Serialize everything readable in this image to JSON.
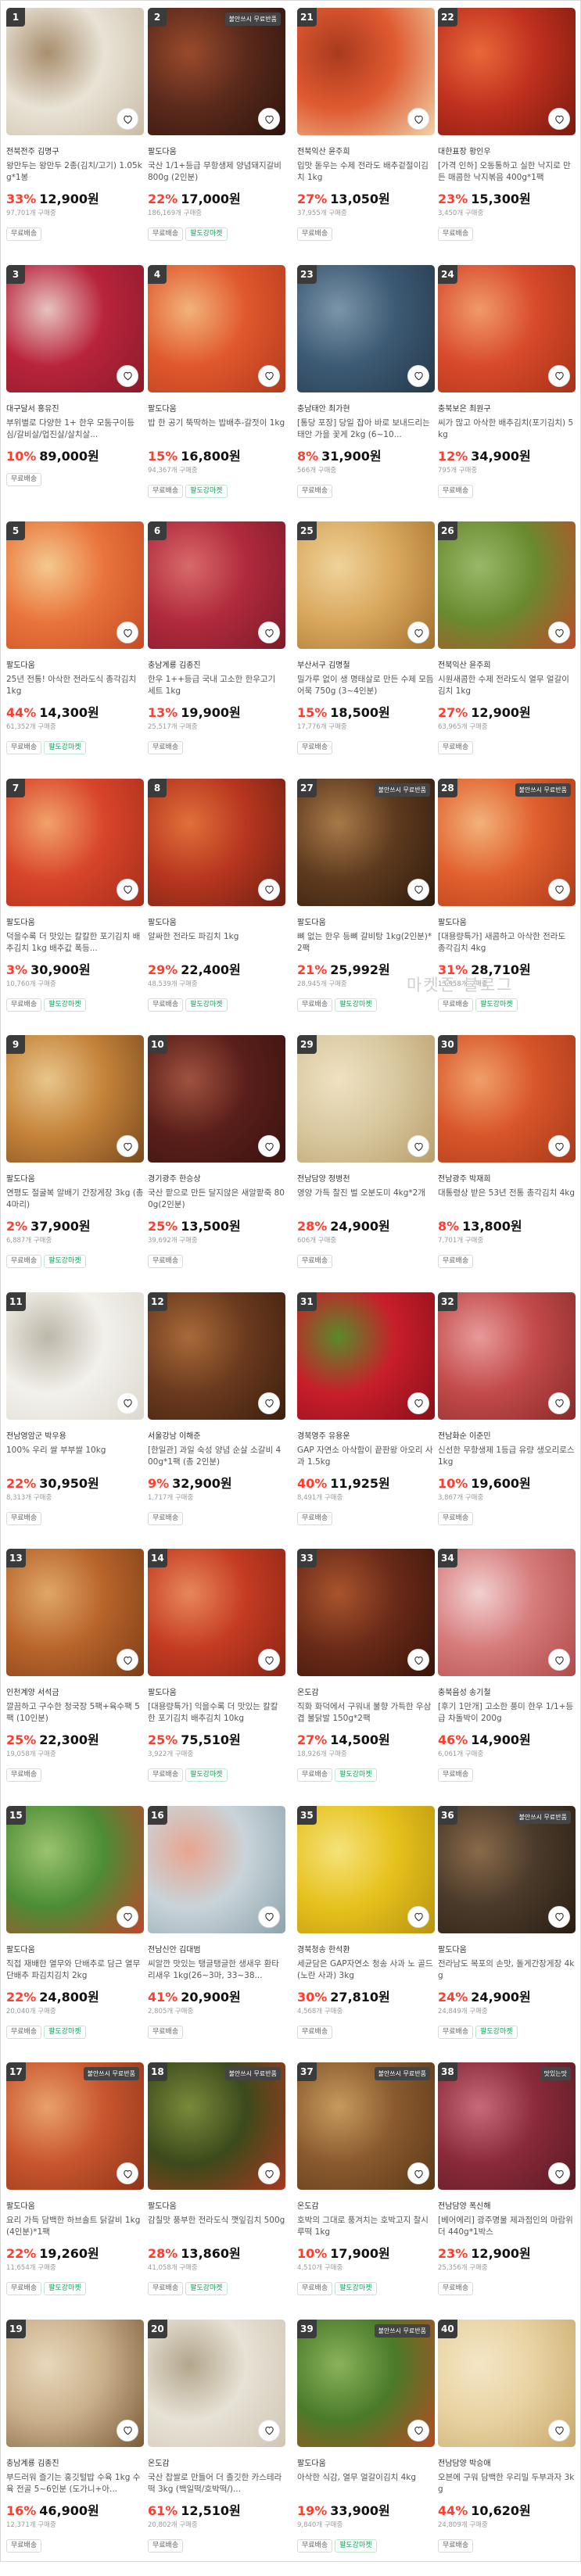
{
  "watermark": "마켓존 블로그",
  "columns": [
    {
      "products": [
        {
          "rank": "1",
          "badge": "",
          "store": "전북전주 김명구",
          "name": "왕만두는 왕만두 2종(김치/고기) 1.05kg*1봉",
          "discount": "33%",
          "price": "12,900원",
          "buyers": "97,701개 구매중",
          "tags": [
            "무료배송"
          ],
          "img_colors": [
            "#e9e3d6",
            "#c9bca6",
            "#a88e6e"
          ]
        },
        {
          "rank": "3",
          "badge": "",
          "store": "대구달서 홍유진",
          "name": "부위별로 다양한 1+ 한우 모둠구이등심/갈비살/업진살/살치살...",
          "discount": "10%",
          "price": "89,000원",
          "buyers": "",
          "tags": [
            "무료배송"
          ],
          "img_colors": [
            "#b8243a",
            "#8c1a2c",
            "#e7c3c0"
          ]
        },
        {
          "rank": "5",
          "badge": "",
          "store": "팔도다움",
          "name": "25년 전통! 아삭한 전라도식 총각김치 1kg",
          "discount": "44%",
          "price": "14,300원",
          "buyers": "61,352개 구매중",
          "tags": [
            "무료배송",
            "팔도강마켓"
          ],
          "img_colors": [
            "#e9743b",
            "#c64b25",
            "#f4c98d"
          ]
        },
        {
          "rank": "7",
          "badge": "",
          "store": "팔도다움",
          "name": "덕을수록 더 맛있는 칼칼한 포기김치 배추김치 1kg 배추값 폭등...",
          "discount": "3%",
          "price": "30,900원",
          "buyers": "10,760개 구매중",
          "tags": [
            "무료배송",
            "팔도강마켓"
          ],
          "img_colors": [
            "#d8452a",
            "#a72d1c",
            "#f2a26a"
          ]
        },
        {
          "rank": "9",
          "badge": "",
          "store": "팔도다움",
          "name": "연평도 절굴복 알배기 간장게장 3kg (총 4마리)",
          "discount": "2%",
          "price": "37,900원",
          "buyers": "6,887개 구매중",
          "tags": [
            "무료배송",
            "팔도강마켓"
          ],
          "img_colors": [
            "#c5833a",
            "#7a4a1e",
            "#e8c68b"
          ]
        },
        {
          "rank": "11",
          "badge": "",
          "store": "전남영암군 박우용",
          "name": "100% 우리 쌀 부부쌀 10kg",
          "discount": "22%",
          "price": "30,950원",
          "buyers": "8,313개 구매중",
          "tags": [
            "무료배송"
          ],
          "img_colors": [
            "#f3f1ec",
            "#dcd8cf",
            "#bdb7a9"
          ]
        },
        {
          "rank": "13",
          "badge": "",
          "store": "인천계양 서석금",
          "name": "깔끔하고 구수한 청국장 5팩+육수팩 5팩 (10인분)",
          "discount": "25%",
          "price": "22,300원",
          "buyers": "19,058개 구매중",
          "tags": [
            "무료배송"
          ],
          "img_colors": [
            "#b8642b",
            "#7d3e16",
            "#e0a768"
          ]
        },
        {
          "rank": "15",
          "badge": "",
          "store": "팔도다움",
          "name": "직접 재배한 열무와 단배추로 담근 열무단배추 파김치김치 2kg",
          "discount": "22%",
          "price": "24,800원",
          "buyers": "20,040개 구매중",
          "tags": [
            "무료배송",
            "팔도강마켓"
          ],
          "img_colors": [
            "#4d8c35",
            "#c0452b",
            "#9bc36f"
          ]
        },
        {
          "rank": "17",
          "badge": "불안쓰시 무료반품",
          "store": "팔도다움",
          "name": "요리 가득 담백한 하브솔트 닭갈비 1kg(4인분)*1팩",
          "discount": "22%",
          "price": "19,260원",
          "buyers": "11,654개 구매중",
          "tags": [
            "무료배송",
            "팔도강마켓"
          ],
          "img_colors": [
            "#c8562e",
            "#8f3419",
            "#e9a16b"
          ]
        },
        {
          "rank": "19",
          "badge": "",
          "store": "충남계룡 김종진",
          "name": "부드러워 즐기는 홍깃털밥 수육 1kg 수육 전골 5~6인분 (도가니+아...",
          "discount": "16%",
          "price": "46,900원",
          "buyers": "12,371개 구매중",
          "tags": [
            "무료배송"
          ],
          "img_colors": [
            "#c9b08a",
            "#7b5a38",
            "#e8d8bd"
          ]
        }
      ]
    },
    {
      "products": [
        {
          "rank": "2",
          "badge": "불안쓰시 무료반품",
          "store": "팔도다움",
          "name": "국산 1/1+등급 무항생제 양념돼지갈비 800g (2인분)",
          "discount": "22%",
          "price": "17,000원",
          "buyers": "186,169개 구매중",
          "tags": [
            "무료배송",
            "팔도강마켓"
          ],
          "img_colors": [
            "#5a2a1c",
            "#2e140c",
            "#9a4a2c"
          ]
        },
        {
          "rank": "4",
          "badge": "",
          "store": "팔도다움",
          "name": "밥 한 공기 뚝딱하는 밥배추-갈젓이 1kg",
          "discount": "15%",
          "price": "16,800원",
          "buyers": "94,367개 구매중",
          "tags": [
            "무료배송",
            "팔도강마켓"
          ],
          "img_colors": [
            "#e0582d",
            "#b33a1c",
            "#f3b37a"
          ]
        },
        {
          "rank": "6",
          "badge": "",
          "store": "충남계룡 김종진",
          "name": "한우 1++등급 국내 고소한 한우고기 세트 1kg",
          "discount": "13%",
          "price": "19,900원",
          "buyers": "25,517개 구매중",
          "tags": [
            "무료배송"
          ],
          "img_colors": [
            "#b02a3c",
            "#7e1a28",
            "#d86a6a"
          ]
        },
        {
          "rank": "8",
          "badge": "",
          "store": "팔도다움",
          "name": "알싸한 전라도 파김치 1kg",
          "discount": "29%",
          "price": "22,400원",
          "buyers": "48,539개 구매중",
          "tags": [
            "무료배송",
            "팔도강마켓"
          ],
          "img_colors": [
            "#b8361f",
            "#6e2013",
            "#e0703a"
          ]
        },
        {
          "rank": "10",
          "badge": "",
          "store": "경기광주 한승상",
          "name": "국산 팥으로 만든 달지않은 새알팥죽 800g(2인분)",
          "discount": "25%",
          "price": "13,500원",
          "buyers": "39,692개 구매중",
          "tags": [
            "무료배송"
          ],
          "img_colors": [
            "#5a1f1a",
            "#3a120f",
            "#a0523f"
          ]
        },
        {
          "rank": "12",
          "badge": "",
          "store": "서울강남 이해준",
          "name": "[한일관] 과일 숙성 양념 순살 소갈비 400g*1팩 (총 2인분)",
          "discount": "9%",
          "price": "32,900원",
          "buyers": "1,717개 구매중",
          "tags": [
            "무료배송"
          ],
          "img_colors": [
            "#6b3a1e",
            "#3c1f0e",
            "#a86a3a"
          ]
        },
        {
          "rank": "14",
          "badge": "",
          "store": "팔도다움",
          "name": "[대용량특가] 익을수록 더 맛있는 칼칼한 포기김치 배추김치 10kg",
          "discount": "25%",
          "price": "75,510원",
          "buyers": "3,922개 구매중",
          "tags": [
            "무료배송",
            "팔도강마켓"
          ],
          "img_colors": [
            "#c43b22",
            "#8a2414",
            "#e8875a"
          ]
        },
        {
          "rank": "16",
          "badge": "",
          "store": "전남신안 김대범",
          "name": "씨알깐 맛있는 탱글탱글한 생새우 환타 리새우 1kg(26~3마, 33~38...",
          "discount": "41%",
          "price": "20,900원",
          "buyers": "2,805개 구매중",
          "tags": [
            "무료배송"
          ],
          "img_colors": [
            "#c9d4d9",
            "#8ea3ad",
            "#e9a58f"
          ]
        },
        {
          "rank": "18",
          "badge": "불안쓰시 무료반품",
          "store": "팔도다움",
          "name": "감칠맛 풍부한 전라도식 깻잎김치 500g",
          "discount": "28%",
          "price": "13,860원",
          "buyers": "41,058개 구매중",
          "tags": [
            "무료배송",
            "팔도강마켓"
          ],
          "img_colors": [
            "#3c4a1c",
            "#a8381e",
            "#7a8a3a"
          ]
        },
        {
          "rank": "20",
          "badge": "",
          "store": "온도감",
          "name": "국산 찹쌀로 만들어 더 졸깃한 카스테라떡 3kg (백일떡/호박떡/)...",
          "discount": "61%",
          "price": "12,510원",
          "buyers": "20,802개 구매중",
          "tags": [
            "무료배송"
          ],
          "img_colors": [
            "#e7e2d6",
            "#cfc6b3",
            "#b3a68c"
          ]
        }
      ]
    },
    {
      "products": [
        {
          "rank": "21",
          "badge": "",
          "store": "전북익산 윤주희",
          "name": "입맛 돋우는 수제 전라도 배추겉절이김치 1kg",
          "discount": "27%",
          "price": "13,050원",
          "buyers": "37,955개 구매중",
          "tags": [
            "무료배송"
          ],
          "img_colors": [
            "#e05a31",
            "#f0d3a8",
            "#a83a1e"
          ]
        },
        {
          "rank": "23",
          "badge": "",
          "store": "충남태안 최가현",
          "name": "[통당 포장] 당일 잡아 바로 보내드리는 태안 가을 꽃게 2kg (6~10...",
          "discount": "8%",
          "price": "31,900원",
          "buyers": "566개 구매중",
          "tags": [
            "무료배송"
          ],
          "img_colors": [
            "#3d5a74",
            "#25394a",
            "#7b95a8"
          ]
        },
        {
          "rank": "25",
          "badge": "",
          "store": "부산서구 김명철",
          "name": "밀가루 없이 생 명태살로 만든 수제 모듬어묵 750g (3~4인분)",
          "discount": "15%",
          "price": "18,500원",
          "buyers": "17,776개 구매중",
          "tags": [
            "무료배송"
          ],
          "img_colors": [
            "#d9a85e",
            "#a36f2c",
            "#efd39a"
          ]
        },
        {
          "rank": "27",
          "badge": "불안쓰시 무료반품",
          "store": "팔도다움",
          "name": "뼈 없는 한우 등뼈 갈비탕 1kg(2인분)*2팩",
          "discount": "21%",
          "price": "25,992원",
          "buyers": "28,945개 구매중",
          "tags": [
            "무료배송",
            "팔도강마켓"
          ],
          "img_colors": [
            "#5e3a1e",
            "#2f1c0e",
            "#a87a4a"
          ]
        },
        {
          "rank": "29",
          "badge": "",
          "store": "전남담양 정병천",
          "name": "영양 가득 찰진 벌 오분도미 4kg*2개",
          "discount": "28%",
          "price": "24,900원",
          "buyers": "606개 구매중",
          "tags": [
            "무료배송"
          ],
          "img_colors": [
            "#d9c8a0",
            "#b89f6c",
            "#efe2c2"
          ]
        },
        {
          "rank": "31",
          "badge": "",
          "store": "경북영주 유용운",
          "name": "GAP 자연소 아삭함이 끝판왕 아오리 사과 1.5kg",
          "discount": "40%",
          "price": "11,925원",
          "buyers": "8,491개 구매중",
          "tags": [
            "무료배송"
          ],
          "img_colors": [
            "#c81e2a",
            "#8a0f18",
            "#5a8a2a"
          ]
        },
        {
          "rank": "33",
          "badge": "",
          "store": "온도감",
          "name": "직화 화덕에서 구워내 불향 가득한 우삼겹 불닭발 150g*2팩",
          "discount": "27%",
          "price": "14,500원",
          "buyers": "18,926개 구매중",
          "tags": [
            "무료배송",
            "팔도강마켓"
          ],
          "img_colors": [
            "#6a2a18",
            "#3a140a",
            "#a8542e"
          ]
        },
        {
          "rank": "35",
          "badge": "",
          "store": "경북청송 한석환",
          "name": "세균담은 GAP자연소 청송 사과 노 골드(노란 사과) 3kg",
          "discount": "30%",
          "price": "27,810원",
          "buyers": "4,568개 구매중",
          "tags": [
            "무료배송"
          ],
          "img_colors": [
            "#e6c21e",
            "#b8940e",
            "#f6e27a"
          ]
        },
        {
          "rank": "37",
          "badge": "불안쓰시 무료반품",
          "store": "온도감",
          "name": "호박의 그대로 풍겨치는 호박고지 찰시루떡 1kg",
          "discount": "10%",
          "price": "17,900원",
          "buyers": "4,510개 구매중",
          "tags": [
            "무료배송",
            "팔도강마켓"
          ],
          "img_colors": [
            "#8a5a2e",
            "#5a3818",
            "#c79a5e"
          ]
        },
        {
          "rank": "39",
          "badge": "불안쓰시 무료반품",
          "store": "팔도다움",
          "name": "아삭한 식감, 열무 얼갈이김치 4kg",
          "discount": "19%",
          "price": "33,900원",
          "buyers": "9,840개 구매중",
          "tags": [
            "무료배송",
            "팔도강마켓"
          ],
          "img_colors": [
            "#4a7a2a",
            "#b84a22",
            "#8ab25a"
          ]
        }
      ]
    },
    {
      "products": [
        {
          "rank": "22",
          "badge": "",
          "store": "대한표장 황인우",
          "name": "[가격 인하] 오동통하고 실한 낙지로 만든 매콤한 낙지볶음 400g*1팩",
          "discount": "23%",
          "price": "15,300원",
          "buyers": "3,450개 구매중",
          "tags": [
            "무료배송"
          ],
          "img_colors": [
            "#c0301e",
            "#7a1a0e",
            "#e8683a"
          ]
        },
        {
          "rank": "24",
          "badge": "",
          "store": "충북보은 최원구",
          "name": "씨가 많고 아삭한 배추김치(포기김치) 5kg",
          "discount": "12%",
          "price": "34,900원",
          "buyers": "795개 구매중",
          "tags": [
            "무료배송"
          ],
          "img_colors": [
            "#d84a2a",
            "#a83218",
            "#f09a6a"
          ]
        },
        {
          "rank": "26",
          "badge": "",
          "store": "전북익산 윤주희",
          "name": "시원새콤한 수제 전라도식 열무 얼갈이 김치 1kg",
          "discount": "27%",
          "price": "12,900원",
          "buyers": "63,965개 구매중",
          "tags": [
            "무료배송"
          ],
          "img_colors": [
            "#6a8a2e",
            "#c04a2a",
            "#9ab86a"
          ]
        },
        {
          "rank": "28",
          "badge": "불안쓰시 무료반품",
          "store": "팔도다움",
          "name": "[대용량특가] 새콤하고 아삭한 전라도 총각김치 4kg",
          "discount": "31%",
          "price": "28,710원",
          "buyers": "13,958개 구매중",
          "tags": [
            "무료배송",
            "팔도강마켓"
          ],
          "img_colors": [
            "#e0602e",
            "#b03a1a",
            "#f3b27a"
          ]
        },
        {
          "rank": "30",
          "badge": "",
          "store": "전남광주 박재희",
          "name": "대통령상 받은 53년 전통 총각김치 4kg",
          "discount": "8%",
          "price": "13,800원",
          "buyers": "7,701개 구매중",
          "tags": [
            "무료배송"
          ],
          "img_colors": [
            "#d8552a",
            "#a83a1a",
            "#f0a06a"
          ]
        },
        {
          "rank": "32",
          "badge": "",
          "store": "전남화순 이준민",
          "name": "신선한 무항생제 1등급 유량 생오리로스 1kg",
          "discount": "10%",
          "price": "19,600원",
          "buyers": "3,867개 구매중",
          "tags": [
            "무료배송"
          ],
          "img_colors": [
            "#c24a4a",
            "#8a2a2a",
            "#e89a9a"
          ]
        },
        {
          "rank": "34",
          "badge": "",
          "store": "충북음성 송기철",
          "name": "[후기 1만개] 고소한 풍미 한우 1/1+등급 차돌박이 200g",
          "discount": "46%",
          "price": "14,900원",
          "buyers": "6,061개 구매중",
          "tags": [
            "무료배송"
          ],
          "img_colors": [
            "#d67a7a",
            "#b04a4a",
            "#f2d0d0"
          ]
        },
        {
          "rank": "36",
          "badge": "불안쓰시 무료반품",
          "store": "팔도다움",
          "name": "전라남도 목포의 손맛, 돌게간장게장 4kg",
          "discount": "24%",
          "price": "24,900원",
          "buyers": "24,849개 구매중",
          "tags": [
            "무료배송",
            "팔도강마켓"
          ],
          "img_colors": [
            "#4a3a2a",
            "#2a1e12",
            "#8a6a4a"
          ]
        },
        {
          "rank": "38",
          "badge": "맛있는맛",
          "store": "전남담양 폭신해",
          "name": "[베어에리] 광주명물 제과점인의 마람위더 440g*1박스",
          "discount": "23%",
          "price": "12,900원",
          "buyers": "25,356개 구매중",
          "tags": [
            "무료배송"
          ],
          "img_colors": [
            "#8a2a3a",
            "#5a1a24",
            "#c86a7a"
          ]
        },
        {
          "rank": "40",
          "badge": "",
          "store": "전남담양 박승애",
          "name": "오븐에 구워 담백한 우리밀 두부과자 3kg",
          "discount": "44%",
          "price": "10,620원",
          "buyers": "24,809개 구매중",
          "tags": [
            "무료배송"
          ],
          "img_colors": [
            "#e8d2a2",
            "#c8a86a",
            "#f4e6c6"
          ]
        }
      ]
    }
  ]
}
